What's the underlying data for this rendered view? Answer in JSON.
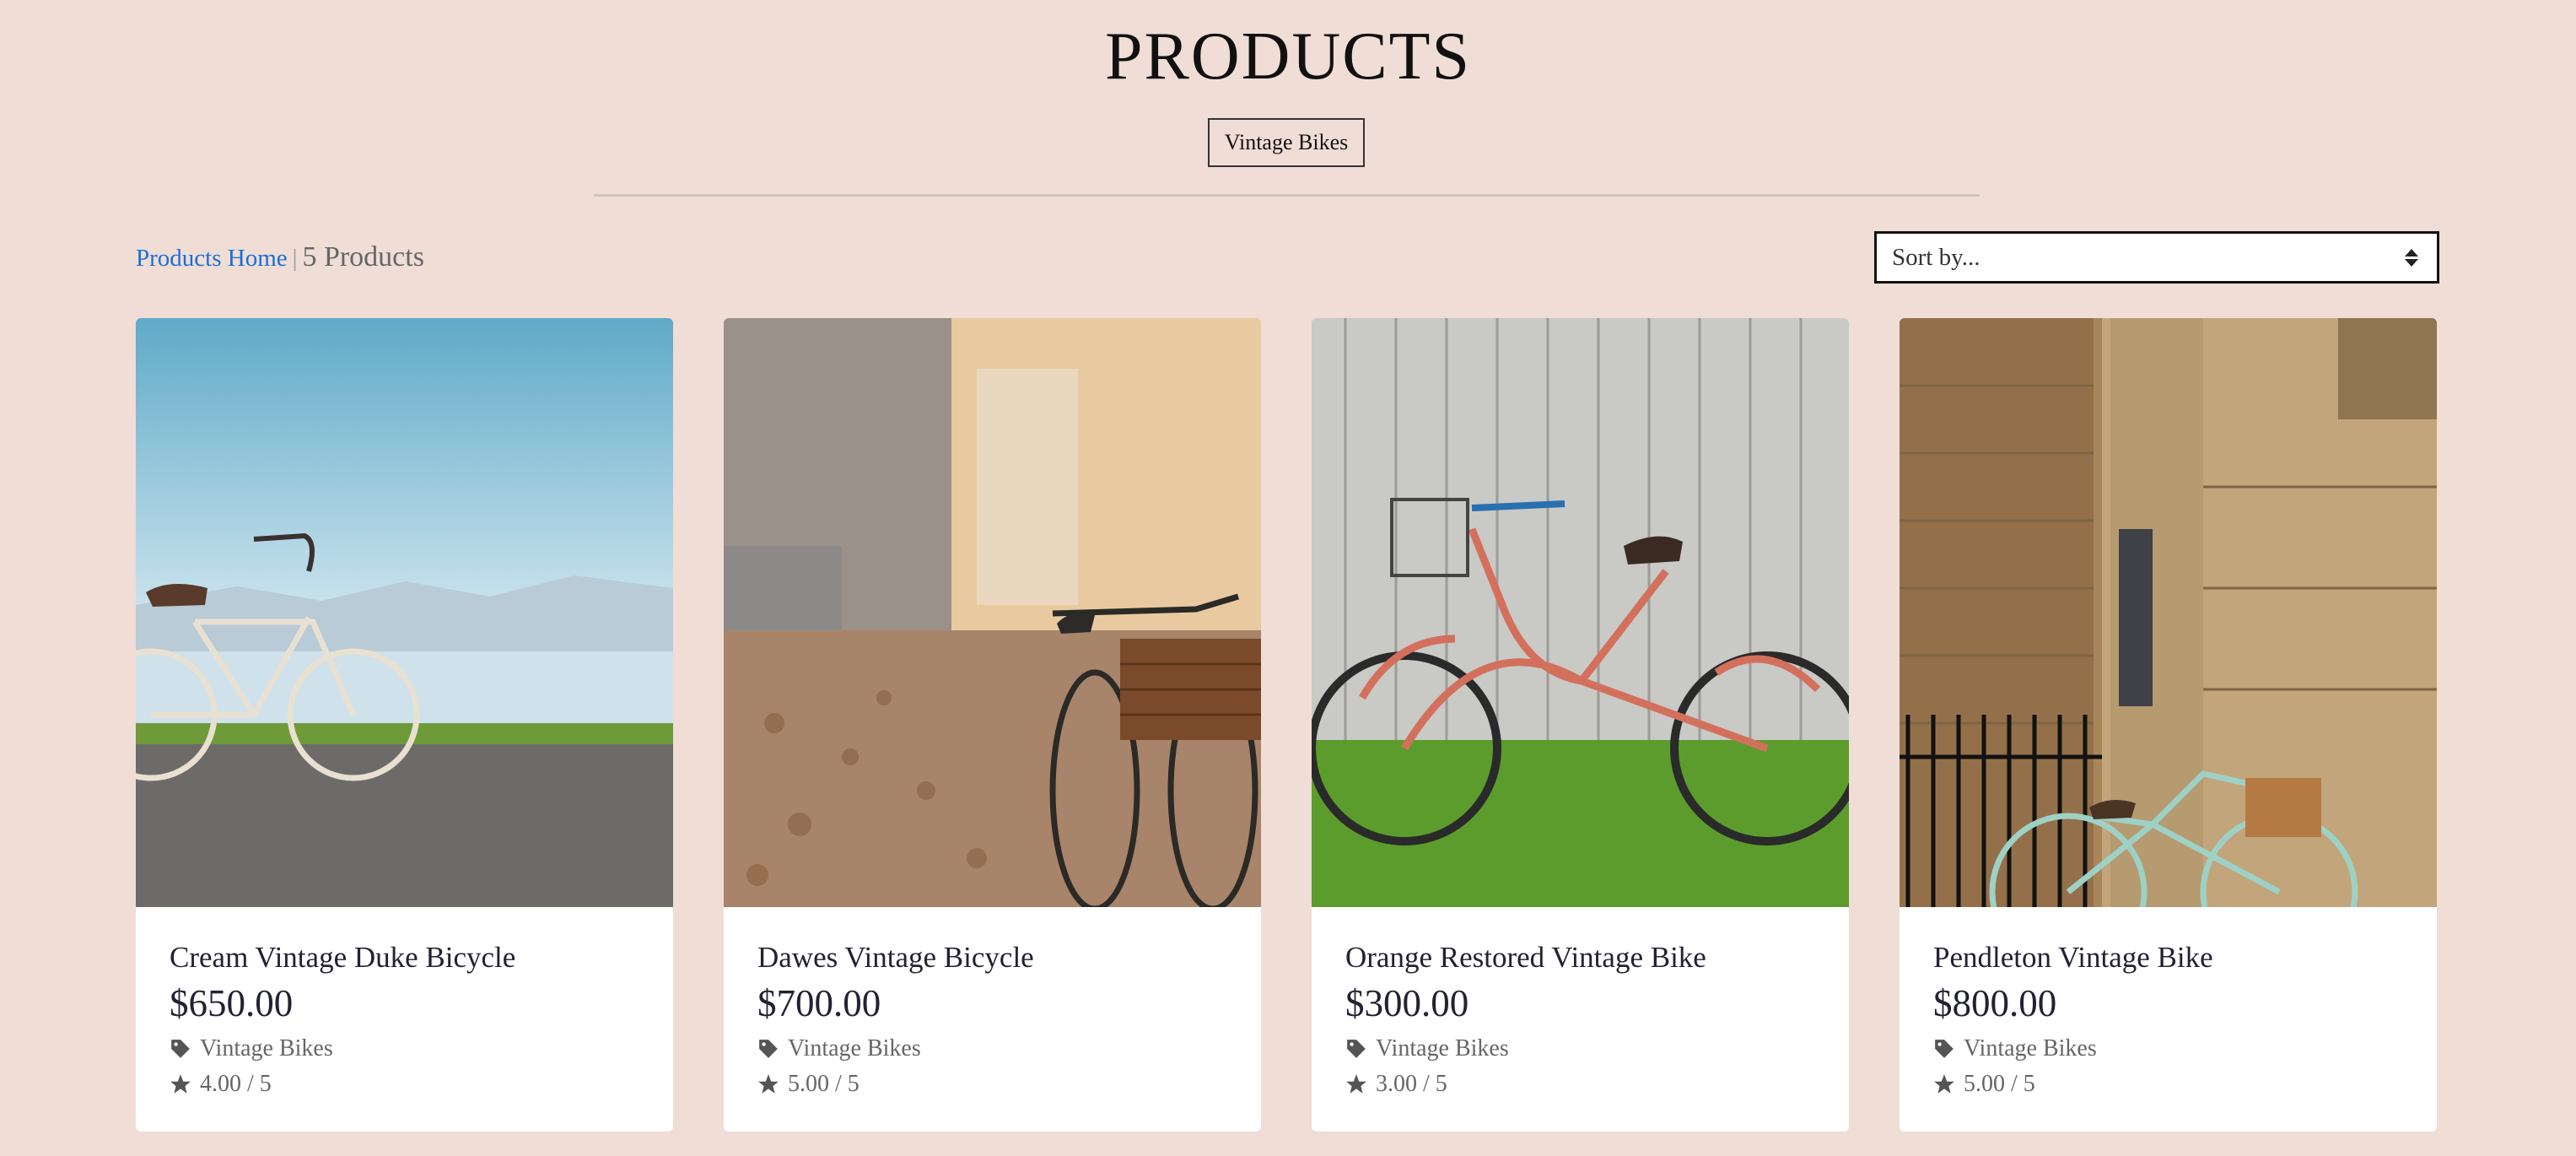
{
  "header": {
    "title": "PRODUCTS",
    "category_pill": "Vintage Bikes"
  },
  "toolbar": {
    "breadcrumb_home": "Products Home",
    "separator": "|",
    "product_count": "5 Products",
    "sort_placeholder": "Sort by..."
  },
  "products": [
    {
      "name": "Cream Vintage Duke Bicycle",
      "price": "$650.00",
      "category": "Vintage Bikes",
      "rating": "4.00 / 5",
      "icon_tag": "tag-icon",
      "icon_star": "star-icon"
    },
    {
      "name": "Dawes Vintage Bicycle",
      "price": "$700.00",
      "category": "Vintage Bikes",
      "rating": "5.00 / 5",
      "icon_tag": "tag-icon",
      "icon_star": "star-icon"
    },
    {
      "name": "Orange Restored Vintage Bike",
      "price": "$300.00",
      "category": "Vintage Bikes",
      "rating": "3.00 / 5",
      "icon_tag": "tag-icon",
      "icon_star": "star-icon"
    },
    {
      "name": "Pendleton Vintage Bike",
      "price": "$800.00",
      "category": "Vintage Bikes",
      "rating": "5.00 / 5",
      "icon_tag": "tag-icon",
      "icon_star": "star-icon"
    }
  ],
  "colors": {
    "background": "#efddd6",
    "link": "#1a6fd6",
    "card": "#ffffff",
    "text": "#223"
  }
}
